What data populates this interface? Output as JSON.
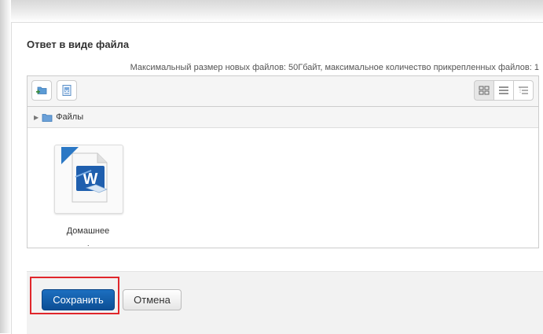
{
  "form": {
    "section_title": "Ответ в виде файла",
    "limits_text": "Максимальный размер новых файлов: 50Гбайт, максимальное количество прикрепленных файлов: 1"
  },
  "filemanager": {
    "toolbar": {
      "add_icon": "folder-add-icon",
      "download_icon": "download-icon",
      "views": [
        {
          "icon": "grid-view-icon",
          "active": true
        },
        {
          "icon": "list-view-icon",
          "active": false
        },
        {
          "icon": "tree-view-icon",
          "active": false
        }
      ]
    },
    "path": {
      "label": "Файлы"
    },
    "files": [
      {
        "name": "Домашнее",
        "name_continued": ".",
        "icon": "word-document-icon"
      }
    ]
  },
  "actions": {
    "save_label": "Сохранить",
    "cancel_label": "Отмена"
  },
  "colors": {
    "save_button": "#1565b8",
    "highlight": "#e0262b"
  }
}
